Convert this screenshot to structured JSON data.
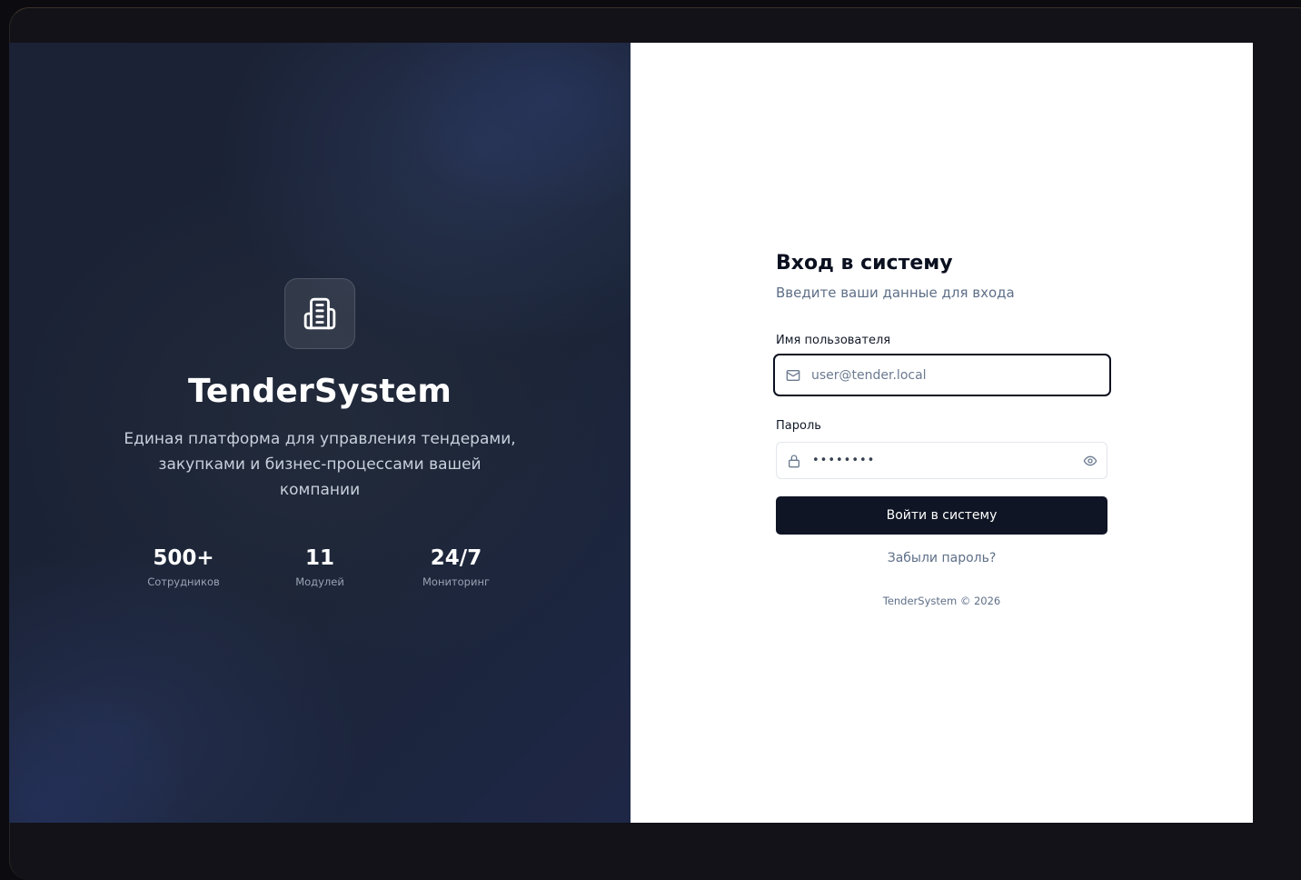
{
  "brand": {
    "name": "TenderSystem",
    "tagline": "Единая платформа для управления тендерами, закупками и бизнес-процессами вашей компании",
    "logo_icon": "building-icon"
  },
  "stats": [
    {
      "value": "500+",
      "label": "Сотрудников"
    },
    {
      "value": "11",
      "label": "Модулей"
    },
    {
      "value": "24/7",
      "label": "Мониторинг"
    }
  ],
  "login": {
    "title": "Вход в систему",
    "subtitle": "Введите ваши данные для входа",
    "username_label": "Имя пользователя",
    "username_placeholder": "user@tender.local",
    "username_icon": "mail-icon",
    "password_label": "Пароль",
    "password_masked": "••••••••",
    "password_icon": "lock-icon",
    "password_toggle_icon": "eye-icon",
    "submit_label": "Войти в систему",
    "forgot_label": "Забыли пароль?",
    "footer": "TenderSystem © 2026"
  },
  "colors": {
    "primary_button": "#0f1524",
    "left_panel_bg": "#1a2235",
    "muted_text": "#5e6f88"
  }
}
